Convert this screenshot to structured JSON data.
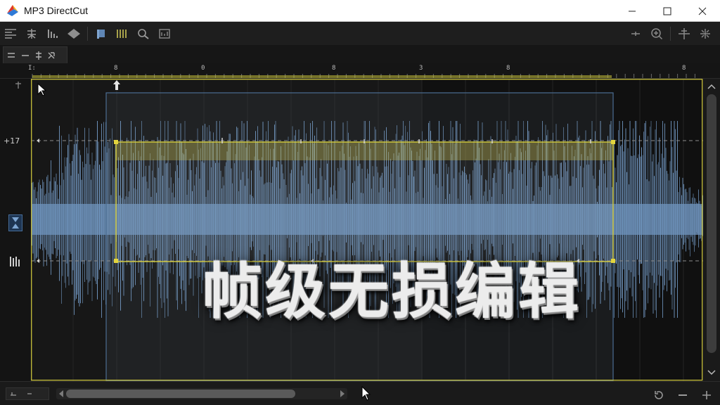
{
  "window": {
    "title": "MP3 DirectCut",
    "controls": [
      "minimize-icon",
      "maximize-icon",
      "close-icon"
    ]
  },
  "toolbar": {
    "left_icons": [
      "align-icon",
      "split-icon",
      "levels-icon",
      "play-icon",
      "marker-icon",
      "grid-icon",
      "zoom-icon",
      "image-icon"
    ],
    "right_icons": [
      "plus-icon",
      "zoom-in-icon",
      "crosshair-icon",
      "resize-icon"
    ]
  },
  "subtoolbar": {
    "tab_icons": [
      "double-line-icon",
      "minus-icon",
      "split-icon",
      "collapse-icon"
    ]
  },
  "ruler": {
    "tick_labels": [
      "8",
      "0",
      "8",
      "3",
      "8",
      "8"
    ]
  },
  "gutter": {
    "db_top": "+17",
    "markers": [
      "marker-cursor-icon",
      "marker-level-icon"
    ]
  },
  "editor": {
    "overlay_title": "帧级无损编辑",
    "accent": "#c8c23a",
    "waveform_color": "#6f94bd",
    "selection_border": "#d8cf3c"
  },
  "bottombar": {
    "icons": [
      "cursor-icon",
      "loop-icon",
      "minus-icon",
      "add-icon"
    ]
  }
}
